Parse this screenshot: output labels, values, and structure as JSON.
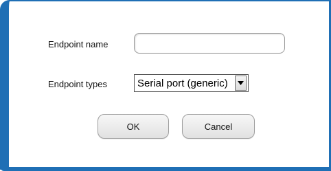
{
  "form": {
    "endpoint_name_label": "Endpoint name",
    "endpoint_name_value": "",
    "endpoint_types_label": "Endpoint types",
    "endpoint_type_selected": "Serial port (generic)"
  },
  "buttons": {
    "ok_label": "OK",
    "cancel_label": "Cancel"
  },
  "colors": {
    "frame_accent": "#1f6fb5"
  },
  "icons": {
    "dropdown": "chevron-down-icon"
  }
}
